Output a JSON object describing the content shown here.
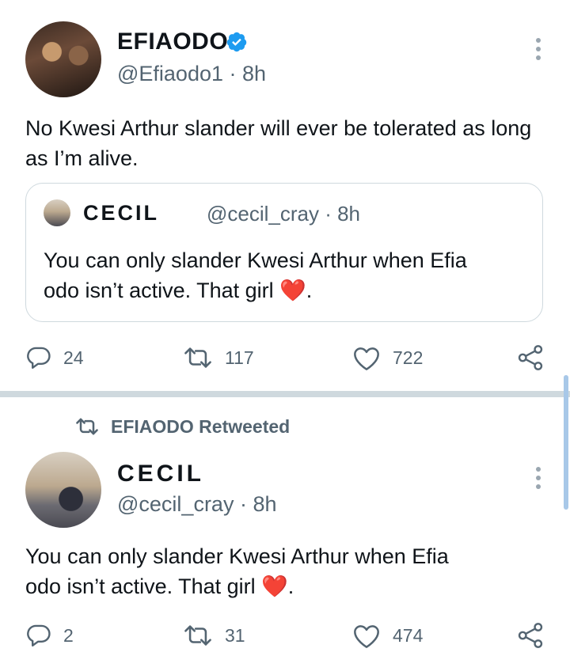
{
  "tweet1": {
    "display_name": "EFIAODO",
    "handle_time": "@Efiaodo1 · 8h",
    "text": "No Kwesi Arthur slander will ever be tolerated as long as I’m alive.",
    "quote": {
      "display_name": "CECIL",
      "handle_time": "@cecil_cray · 8h",
      "text_line1": "You can only slander Kwesi Arthur when Efia",
      "text_line2": "odo isn’t active. That girl",
      "text_emoji": "❤️",
      "text_end": "."
    },
    "actions": {
      "replies": "24",
      "retweets": "117",
      "likes": "722"
    }
  },
  "retweet_banner": "EFIAODO Retweeted",
  "tweet2": {
    "display_name": "CECIL",
    "handle_time": "@cecil_cray · 8h",
    "text_line1": "You can only slander Kwesi Arthur when Efia",
    "text_line2": "odo isn’t active. That girl",
    "text_emoji": "❤️",
    "text_end": ".",
    "actions": {
      "replies": "2",
      "retweets": "31",
      "likes": "474"
    }
  },
  "colors": {
    "verified": "#1d9bf0",
    "secondary_text": "#536471",
    "heart": "#e0245e"
  }
}
